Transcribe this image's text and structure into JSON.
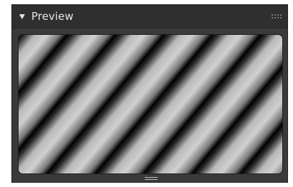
{
  "panel": {
    "title": "Preview",
    "collapse_icon": "triangle-down-icon",
    "drag_icon": "drag-grip-icon",
    "resize_icon": "resize-handle-icon"
  },
  "preview": {
    "pattern": "diagonal-stripes",
    "stripe_dark": "#000000",
    "stripe_light": "#cfcfcf"
  },
  "colors": {
    "panel_bg": "#3a3a3a",
    "header_bg": "#2f2f2f",
    "text": "#e6e6e6"
  }
}
